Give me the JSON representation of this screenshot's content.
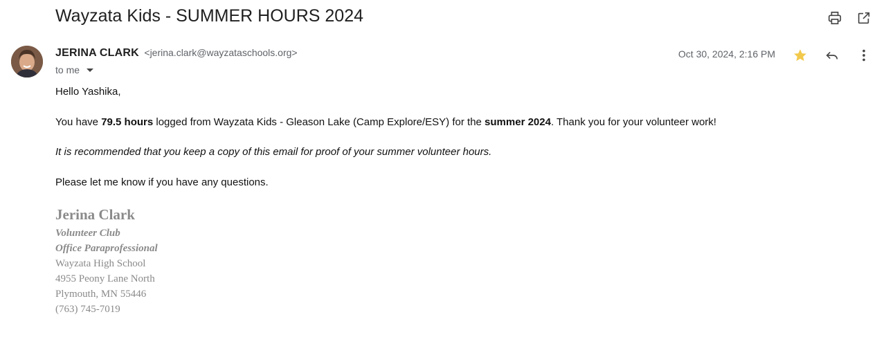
{
  "email": {
    "subject": "Wayzata Kids - SUMMER HOURS 2024",
    "sender_name": "JERINA CLARK",
    "sender_email": "<jerina.clark@wayzataschools.org>",
    "recipient_label": "to me",
    "date": "Oct 30, 2024, 2:16 PM",
    "starred": true,
    "star_color": "#f2c94c"
  },
  "body": {
    "greeting": "Hello Yashika,",
    "p1_a": "You have ",
    "p1_hours": "79.5 hours",
    "p1_b": " logged from Wayzata Kids - Gleason Lake (Camp Explore/ESY) for the ",
    "p1_season": "summer 2024",
    "p1_c": ". Thank you for your volunteer work!",
    "p2": "It is recommended that you keep a copy of this email for proof of your summer volunteer hours.",
    "p3": "Please let me know if you have any questions."
  },
  "signature": {
    "name": "Jerina Clark",
    "line1": "Volunteer Club",
    "line2": "Office Paraprofessional",
    "line3": "Wayzata High School",
    "line4": "4955 Peony Lane North",
    "line5": "Plymouth, MN 55446",
    "line6": "(763) 745-7019"
  },
  "icons": {
    "print": "print-icon",
    "open_new": "open-in-new-window-icon",
    "star": "star-icon",
    "reply": "reply-icon",
    "more": "more-vertical-icon"
  }
}
